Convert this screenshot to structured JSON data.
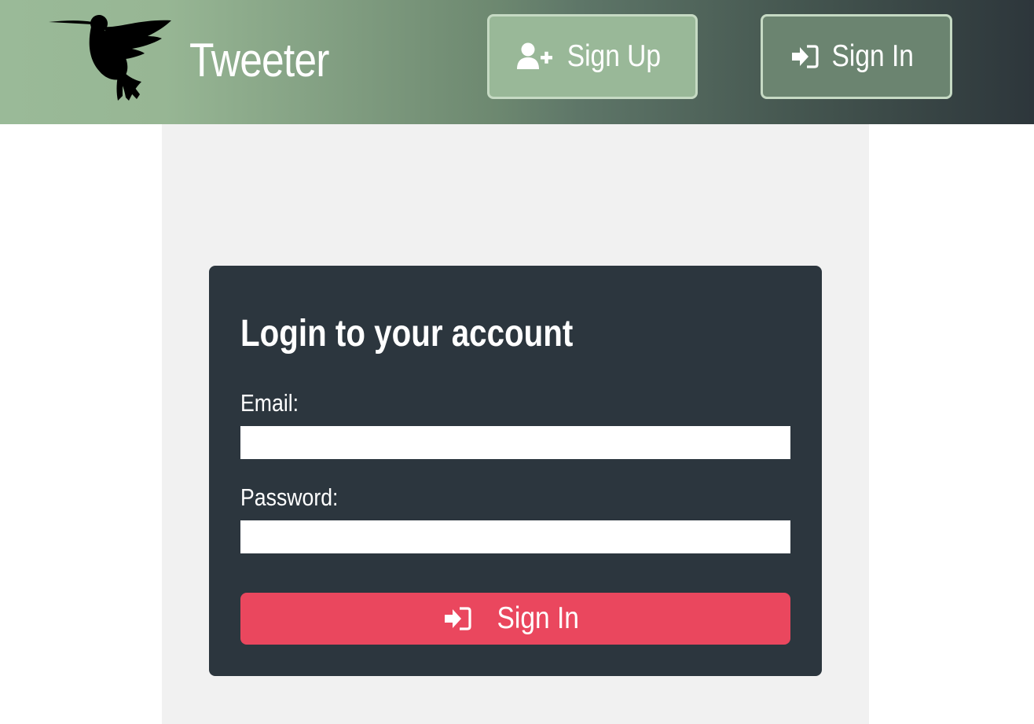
{
  "header": {
    "brand": "Tweeter",
    "logo_icon": "hummingbird-icon",
    "signup": {
      "label": "Sign Up",
      "icon": "user-plus-icon"
    },
    "signin": {
      "label": "Sign In",
      "icon": "sign-in-icon"
    }
  },
  "login_form": {
    "title": "Login to your account",
    "email_label": "Email:",
    "email_value": "",
    "password_label": "Password:",
    "password_value": "",
    "submit": {
      "label": "Sign In",
      "icon": "sign-in-icon"
    }
  },
  "colors": {
    "header_gradient_start": "#9aba98",
    "header_gradient_end": "#2d363b",
    "signup_button": "#99b898",
    "signin_button": "#6b8470",
    "panel_background": "#f1f1f1",
    "card_background": "#2c363e",
    "submit_button": "#ea475e"
  }
}
